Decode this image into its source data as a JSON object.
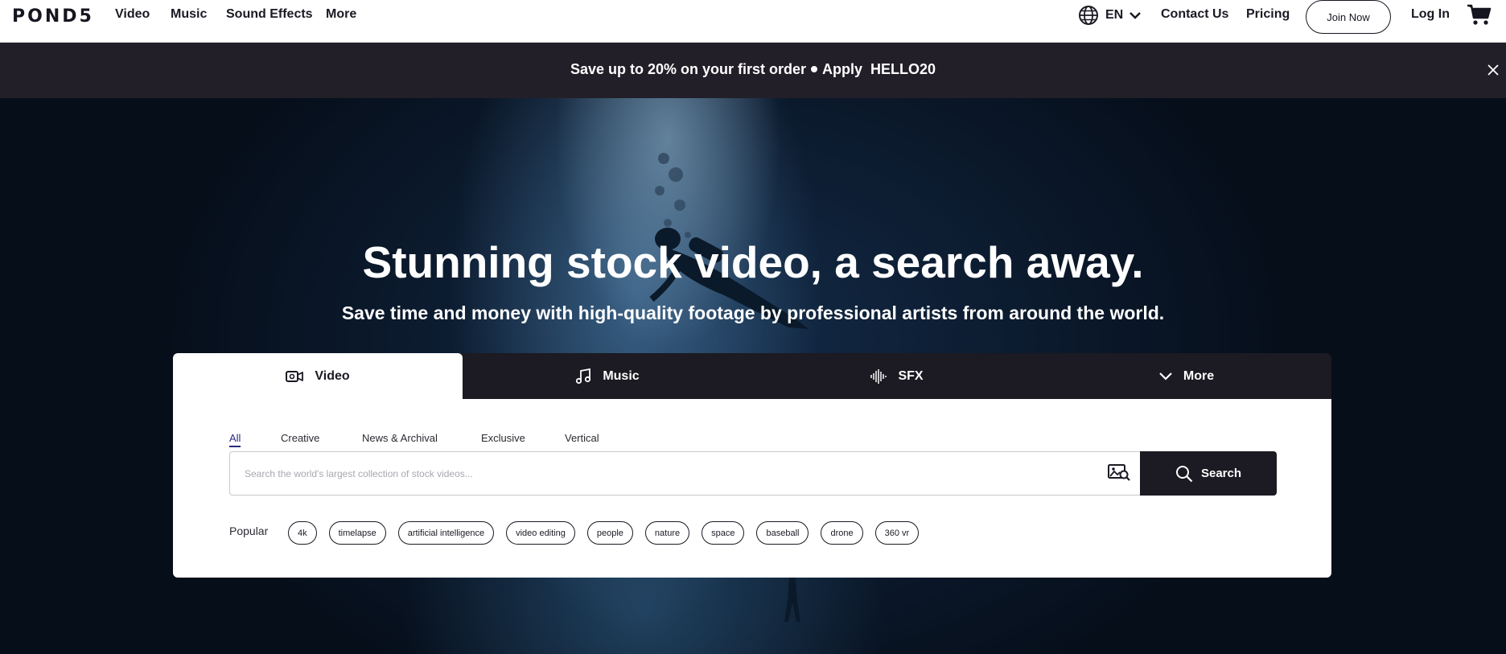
{
  "nav": {
    "logo": "POND5",
    "links": [
      "Video",
      "Music",
      "Sound Effects",
      "More"
    ],
    "language": "EN",
    "contact": "Contact Us",
    "pricing": "Pricing",
    "join": "Join Now",
    "login": "Log In"
  },
  "promo": {
    "text": "Save up to 20% on your first order",
    "apply": "Apply",
    "code": "HELLO20"
  },
  "hero": {
    "headline": "Stunning stock video, a search away.",
    "subline": "Save time and money with high-quality footage by professional artists from around the world."
  },
  "search": {
    "tabs": [
      "Video",
      "Music",
      "SFX",
      "More"
    ],
    "active_tab": "Video",
    "filters": [
      "All",
      "Creative",
      "News & Archival",
      "Exclusive",
      "Vertical"
    ],
    "active_filter": "All",
    "placeholder": "Search the world's largest collection of stock videos...",
    "button": "Search",
    "popular_label": "Popular",
    "popular": [
      "4k",
      "timelapse",
      "artificial intelligence",
      "video editing",
      "people",
      "nature",
      "space",
      "baseball",
      "drone",
      "360 vr"
    ]
  },
  "icons": {
    "language": "globe-icon",
    "language_chevron": "chevron-down-icon",
    "cart": "cart-icon",
    "promo_close": "close-icon",
    "tab_video": "video-camera-icon",
    "tab_music": "music-note-icon",
    "tab_sfx": "waveform-icon",
    "tab_more": "chevron-down-icon",
    "image_search": "image-search-icon",
    "search": "search-icon"
  },
  "colors": {
    "dark": "#1c1a22",
    "promo_bg": "#221f28",
    "active_filter": "#2a2a80",
    "white": "#ffffff"
  }
}
